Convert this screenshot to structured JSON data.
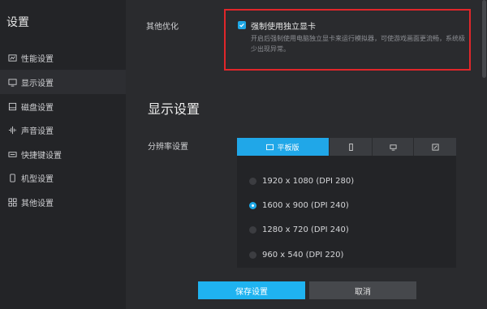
{
  "sidebar": {
    "title": "设置",
    "items": [
      {
        "label": "性能设置",
        "icon": "performance-icon",
        "active": false
      },
      {
        "label": "显示设置",
        "icon": "display-icon",
        "active": true
      },
      {
        "label": "磁盘设置",
        "icon": "disk-icon",
        "active": false
      },
      {
        "label": "声音设置",
        "icon": "sound-icon",
        "active": false
      },
      {
        "label": "快捷键设置",
        "icon": "keyboard-icon",
        "active": false
      },
      {
        "label": "机型设置",
        "icon": "phone-icon",
        "active": false
      },
      {
        "label": "其他设置",
        "icon": "grid-icon",
        "active": false
      }
    ]
  },
  "other_opt": {
    "label": "其他优化",
    "checkbox_label": "强制使用独立显卡",
    "checked": true,
    "description": "开启后强制使用电脑独立显卡来运行模拟器，可使游戏画面更流畅，系统极少出现异常。"
  },
  "display": {
    "section_title": "显示设置",
    "resolution_label": "分辨率设置",
    "tabs": [
      {
        "label": "平板版",
        "icon": "tablet-icon",
        "active": true
      },
      {
        "label": "",
        "icon": "phone-portrait-icon",
        "active": false
      },
      {
        "label": "",
        "icon": "monitor-icon",
        "active": false
      },
      {
        "label": "",
        "icon": "edit-icon",
        "active": false
      }
    ],
    "resolutions": [
      {
        "label": "1920 x 1080 (DPI 280)",
        "selected": false
      },
      {
        "label": "1600 x 900 (DPI 240)",
        "selected": true
      },
      {
        "label": "1280 x 720 (DPI 240)",
        "selected": false
      },
      {
        "label": "960 x 540 (DPI 220)",
        "selected": false
      }
    ]
  },
  "buttons": {
    "save": "保存设置",
    "cancel": "取消"
  },
  "colors": {
    "accent": "#1ea8e6",
    "highlight_border": "#e0262a"
  }
}
